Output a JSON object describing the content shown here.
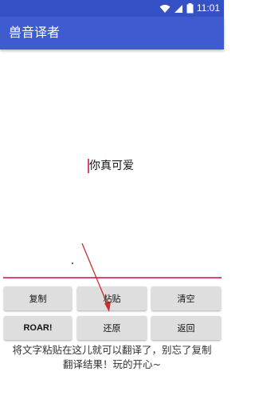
{
  "status_bar": {
    "time": "11:01",
    "icons": [
      "wifi-icon",
      "signal-icon",
      "battery-icon"
    ]
  },
  "app_bar": {
    "title": "兽音译者"
  },
  "editor": {
    "text": "你真可爱"
  },
  "buttons": {
    "copy": "复制",
    "paste": "粘贴",
    "clear": "清空",
    "roar": "ROAR!",
    "restore": "还原",
    "back": "返回"
  },
  "hint": {
    "line1": "将文字粘贴在这儿就可以翻译了，别忘了复制",
    "line2": "翻译结果！玩的开心~"
  },
  "colors": {
    "primary": "#3f5bd0",
    "primary_dark": "#3551c6",
    "accent": "#e0457a",
    "button_bg": "#dedede",
    "annotation_arrow": "#c8302f"
  }
}
